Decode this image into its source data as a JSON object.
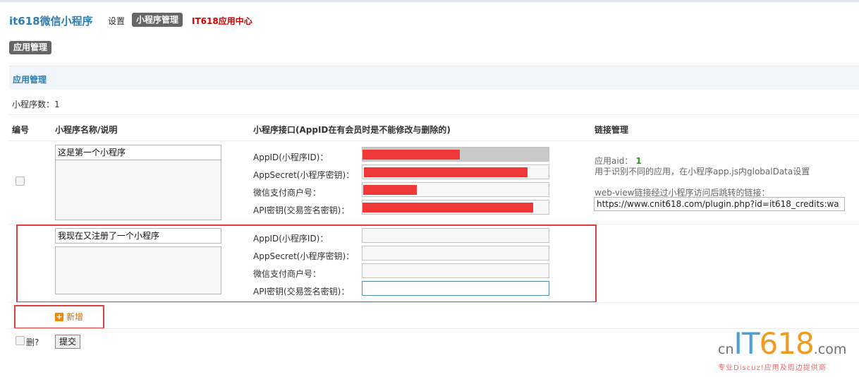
{
  "header": {
    "brand": "it618微信小程序",
    "nav_settings": "设置",
    "nav_active": "小程序管理",
    "nav_center": "IT618应用中心"
  },
  "subtab": "应用管理",
  "panel": {
    "title": "应用管理",
    "count_label": "小程序数：1"
  },
  "table": {
    "headers": {
      "id": "编号",
      "name": "小程序名称/说明",
      "api": "小程序接口(AppID在有会员时是不能修改与删除的)",
      "links": "链接管理"
    },
    "field_labels": {
      "appid": "AppID(小程序ID)：",
      "appsecret": "AppSecret(小程序密钥)：",
      "mch": "微信支付商户号：",
      "apikey": "API密钥(交易签名密钥)："
    },
    "rows": [
      {
        "name": "这是第一个小程序",
        "desc": ""
      },
      {
        "name": "我现在又注册了一个小程序",
        "desc": ""
      }
    ]
  },
  "links": {
    "aid_label": "应用aid：",
    "aid_value": "1",
    "aid_note": "用于识别不同的应用，在小程序app.js内globalData设置",
    "webview_note": "web-view链接经过小程序访问后跳转的链接：",
    "webview_url": "https://www.cnit618.com/plugin.php?id=it618_credits:wa"
  },
  "actions": {
    "add_label": "新增",
    "delete_label": "删?",
    "submit_label": "提交"
  },
  "colors": {
    "brand": "#2b7fb0",
    "nav_center": "#d40000",
    "redaction": "#f03838",
    "highlight": "#e04040",
    "aid_value": "#2c9a1c"
  },
  "watermark": {
    "logo_text": "cnIT618.com",
    "tagline": "专业Discuz!应用及周边提供商"
  }
}
